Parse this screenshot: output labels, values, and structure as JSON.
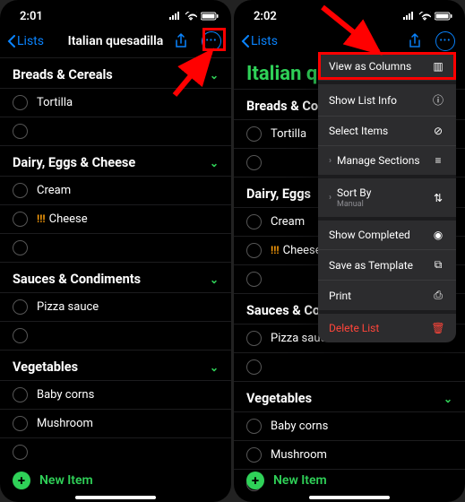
{
  "left": {
    "time": "2:01",
    "back": "Lists",
    "title": "Italian quesadilla",
    "sections": {
      "breads": {
        "title": "Breads & Cereals",
        "items": [
          "Tortilla"
        ]
      },
      "dairy": {
        "title": "Dairy, Eggs & Cheese",
        "items": [
          "Cream",
          "Cheese"
        ],
        "cheese_priority": "!!!"
      },
      "sauces": {
        "title": "Sauces & Condiments",
        "items": [
          "Pizza sauce"
        ]
      },
      "veg": {
        "title": "Vegetables",
        "items": [
          "Baby corns",
          "Mushroom"
        ]
      }
    },
    "new_item": "New Item"
  },
  "right": {
    "time": "2:02",
    "back": "Lists",
    "title_partial": "Italian q",
    "sections": {
      "breads": {
        "title": "Breads & Co",
        "items": [
          "Tortilla"
        ]
      },
      "dairy": {
        "title": "Dairy, Eggs",
        "items": [
          "Cream",
          "Cheese"
        ],
        "cheese_priority": "!!!"
      },
      "sauces": {
        "title": "Sauces & Co",
        "items": [
          "Pizza sauce"
        ]
      },
      "veg": {
        "title": "Vegetables",
        "items": [
          "Baby corns",
          "Mushroom"
        ]
      }
    },
    "new_item": "New Item",
    "menu": {
      "view_columns": "View as Columns",
      "show_info": "Show List Info",
      "select_items": "Select Items",
      "manage_sections": "Manage Sections",
      "sort_by": "Sort By",
      "sort_sub": "Manual",
      "show_completed": "Show Completed",
      "save_template": "Save as Template",
      "print": "Print",
      "delete": "Delete List"
    }
  }
}
